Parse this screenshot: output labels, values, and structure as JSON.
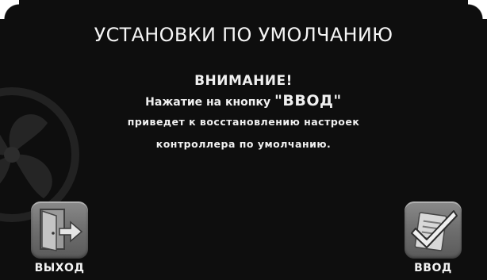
{
  "screen": {
    "title": "УСТАНОВКИ ПО УМОЛЧАНИЮ"
  },
  "warning": {
    "heading": "ВНИМАНИЕ!",
    "line1_prefix": "Нажатие на кнопку ",
    "line1_button": "\"ВВОД\"",
    "line2": "приведет к восстановлению настроек",
    "line3": "контроллера по умолчанию."
  },
  "buttons": {
    "exit_label": "ВЫХОД",
    "enter_label": "ВВОД"
  },
  "icons": {
    "exit": "door-exit-icon",
    "enter": "checklist-confirm-icon",
    "watermark": "fan-watermark-icon"
  },
  "colors": {
    "background": "#0e0e0e",
    "text": "#f2f2f2",
    "button_tile": "#707070"
  }
}
